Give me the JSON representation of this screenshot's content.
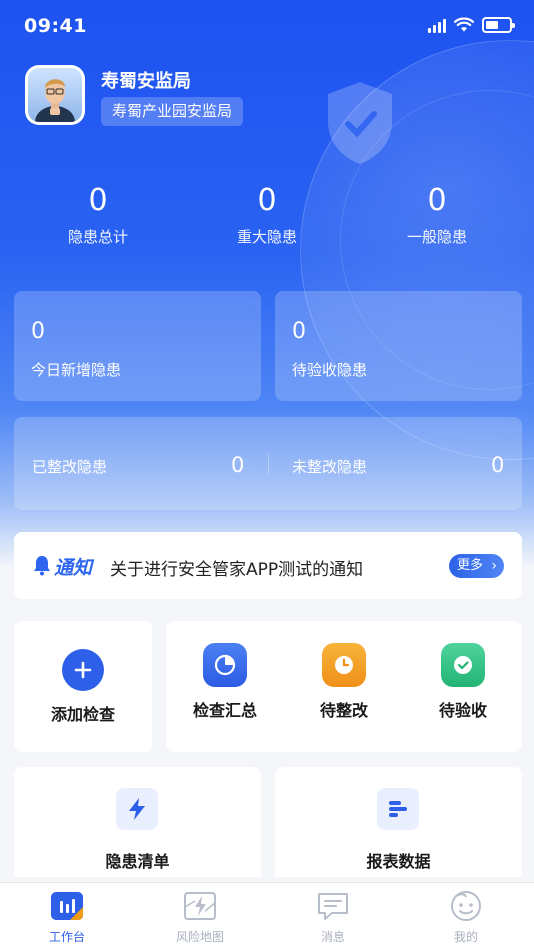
{
  "status_bar": {
    "time": "09:41"
  },
  "profile": {
    "org_name": "寿蜀安监局",
    "org_sub": "寿蜀产业园安监局"
  },
  "stats": [
    {
      "value": "0",
      "label": "隐患总计"
    },
    {
      "value": "0",
      "label": "重大隐患"
    },
    {
      "value": "0",
      "label": "一般隐患"
    }
  ],
  "cards": {
    "today_new": {
      "value": "0",
      "label": "今日新增隐患"
    },
    "pending_accept": {
      "value": "0",
      "label": "待验收隐患"
    },
    "rectified": {
      "value": "0",
      "label": "已整改隐患"
    },
    "unrectified": {
      "value": "0",
      "label": "未整改隐患"
    }
  },
  "notice": {
    "tag": "通知",
    "text": "关于进行安全管家APP测试的通知",
    "more": "更多"
  },
  "quick_actions": {
    "add_check": "添加检查",
    "check_summary": "检查汇总",
    "pending_rectify": "待整改",
    "pending_accept": "待验收"
  },
  "bottom_cards": {
    "hazard_list": "隐患清单",
    "report_data": "报表数据"
  },
  "tabs": [
    {
      "label": "工作台"
    },
    {
      "label": "风险地图"
    },
    {
      "label": "消息"
    },
    {
      "label": "我的"
    }
  ],
  "colors": {
    "primary": "#2d5fe8",
    "orange": "#f39a17",
    "green": "#2ebd82",
    "tab_inactive": "#a9b0bd"
  }
}
